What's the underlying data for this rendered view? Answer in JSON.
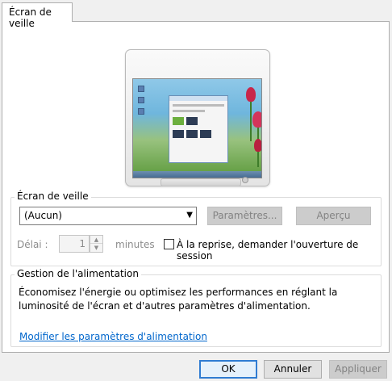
{
  "tabs": [
    {
      "label": "Écran de veille"
    }
  ],
  "screensaver_group": {
    "label": "Écran de veille",
    "selected": "(Aucun)",
    "settings_button": "Paramètres...",
    "preview_button": "Aperçu",
    "delay_label": "Délai :",
    "delay_value": "1",
    "minutes_label": "minutes",
    "resume_checkbox_label": "À la reprise, demander l'ouverture de session",
    "resume_checked": false
  },
  "power_group": {
    "label": "Gestion de l'alimentation",
    "description": "Économisez l'énergie ou optimisez les performances en réglant la luminosité de l'écran et d'autres paramètres d'alimentation.",
    "link": "Modifier les paramètres d'alimentation"
  },
  "footer": {
    "ok": "OK",
    "cancel": "Annuler",
    "apply": "Appliquer"
  }
}
